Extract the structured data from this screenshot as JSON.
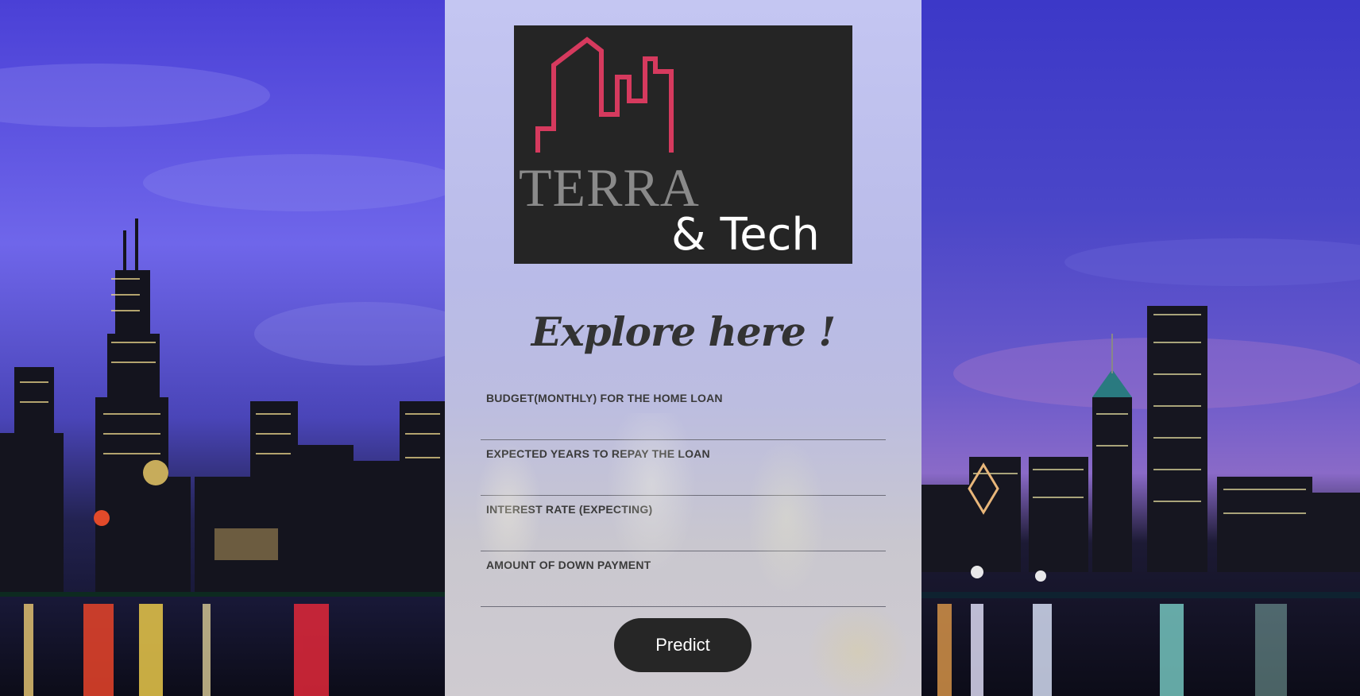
{
  "brand": {
    "logo_word1": "TERRA",
    "logo_word2": "& Tech",
    "logo_accent": "#d63a5e"
  },
  "heading": "Explore here !",
  "form": {
    "fields": [
      {
        "label": "BUDGET(MONTHLY) FOR THE HOME LOAN",
        "value": ""
      },
      {
        "label": "EXPECTED YEARS TO REPAY THE LOAN",
        "value": ""
      },
      {
        "label": "INTEREST RATE (EXPECTING)",
        "value": ""
      },
      {
        "label": "AMOUNT OF DOWN PAYMENT",
        "value": ""
      }
    ],
    "submit_label": "Predict"
  },
  "colors": {
    "panel": "#c1c2ee",
    "button": "#262626",
    "logo_bg": "#252525"
  }
}
